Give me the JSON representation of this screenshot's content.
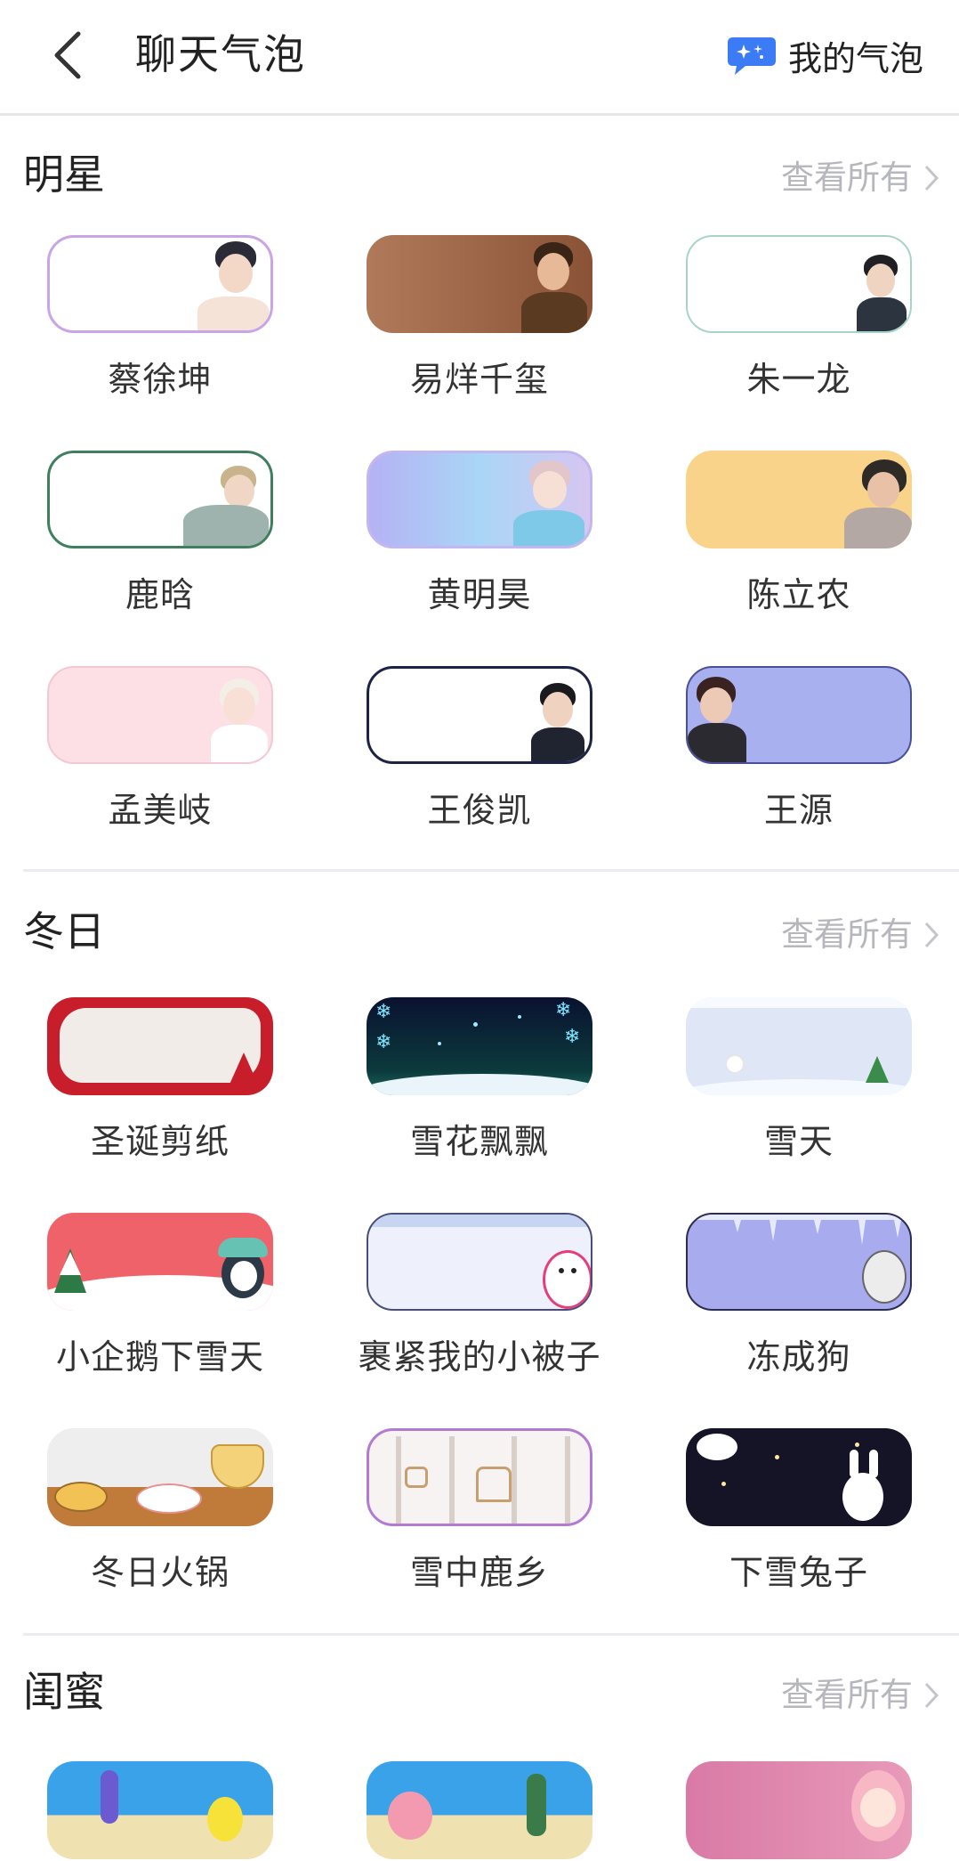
{
  "header": {
    "title": "聊天气泡",
    "my_bubble": "我的气泡"
  },
  "sections": [
    {
      "title": "明星",
      "view_all": "查看所有",
      "items": [
        "蔡徐坤",
        "易烊千玺",
        "朱一龙",
        "鹿晗",
        "黄明昊",
        "陈立农",
        "孟美岐",
        "王俊凯",
        "王源"
      ]
    },
    {
      "title": "冬日",
      "view_all": "查看所有",
      "items": [
        "圣诞剪纸",
        "雪花飘飘",
        "雪天",
        "小企鹅下雪天",
        "裹紧我的小被子",
        "冻成狗",
        "冬日火锅",
        "雪中鹿乡",
        "下雪兔子"
      ]
    },
    {
      "title": "闺蜜",
      "view_all": "查看所有",
      "items": []
    }
  ],
  "colors": {
    "accent_blue": "#3b7bf5",
    "muted_text": "#b6b6bd",
    "divider": "#ececf0"
  }
}
